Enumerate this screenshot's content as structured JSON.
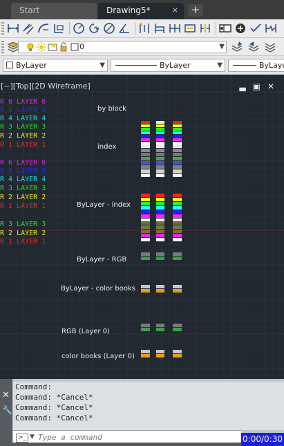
{
  "tabs": [
    {
      "label": "Start",
      "active": false
    },
    {
      "label": "Drawing5*",
      "active": true
    }
  ],
  "tab_close_glyph": "×",
  "tab_add_glyph": "+",
  "layer_toolbar": {
    "current_layer": "0",
    "icons": [
      "layer-properties-icon",
      "light-bulb-icon",
      "sun-freeze-icon",
      "lock-icon",
      "color-square-icon"
    ]
  },
  "properties_toolbar": {
    "color": "ByLayer",
    "linetype": "ByLayer",
    "lineweight": "ByLayer"
  },
  "viewport": {
    "label": "[−][Top][2D Wireframe]",
    "controls": [
      "▃",
      "▣",
      "✕"
    ]
  },
  "legend": [
    {
      "text": "R 6  LAYER 6",
      "color": "#e020e0"
    },
    {
      "text": "R 5  LAYER 5",
      "color": "#2a2ad8"
    },
    {
      "text": "R 4  LAYER 4",
      "color": "#2ad8e6"
    },
    {
      "text": "R 3  LAYER 3",
      "color": "#2ad82a"
    },
    {
      "text": "R 2  LAYER 2",
      "color": "#e6e62a"
    },
    {
      "text": "R 1  LAYER 1",
      "color": "#e62a2a"
    },
    {
      "text": "R 6  LAYER 6",
      "color": "#e020e0"
    },
    {
      "text": "R 5  LAYER 5",
      "color": "#2a2ad8"
    },
    {
      "text": "R 4  LAYER 4",
      "color": "#2ad8e6"
    },
    {
      "text": "R 3  LAYER 3",
      "color": "#2ad82a"
    },
    {
      "text": "R 2  LAYER 2",
      "color": "#e6e62a"
    },
    {
      "text": "R 1  LAYER 1",
      "color": "#e62a2a"
    },
    {
      "text": "R 3  LAYER 3",
      "color": "#2ad82a"
    },
    {
      "text": "R 2  LAYER 2",
      "color": "#e6e62a"
    },
    {
      "text": "R 1  LAYER 1",
      "color": "#e62a2a"
    }
  ],
  "sections": [
    {
      "label": "by block",
      "colors": [
        "#ff2020",
        "#ffff20",
        "#20ff20",
        "#20ffff",
        "#2020ff",
        "#ff20ff",
        "#ffffff"
      ]
    },
    {
      "label": "index",
      "colors": [
        "#e8e8e8",
        "#8c8c8c",
        "#787878",
        "#50a050",
        "#5050d0",
        "#808080",
        "#d0d0d0",
        "#ffffff"
      ]
    },
    {
      "label": "ByLayer - index",
      "colors": [
        "#ff2020",
        "#ffff20",
        "#20ff20",
        "#20ffff",
        "#2020ff",
        "#ff20ff",
        "#ffffff"
      ]
    },
    {
      "label": "",
      "colors": [
        "#6f6a40",
        "#6a8040",
        "#8a6a30",
        "#ff20ff",
        "#ffffff"
      ]
    },
    {
      "label": "ByLayer - RGB",
      "colors": [
        "#7a7a7a",
        "#3aa04a"
      ]
    },
    {
      "label": "ByLayer - color books",
      "colors": [
        "#c8c8c8",
        "#e8a010"
      ]
    },
    {
      "label": "RGB (Layer 0)",
      "colors": [
        "#7a7a7a",
        "#3aa04a"
      ]
    },
    {
      "label": "color books (Layer 0)",
      "colors": [
        "#c8c8c8",
        "#e8a010"
      ]
    }
  ],
  "command_history": [
    "Command:",
    "Command: *Cancel*",
    "Command: *Cancel*",
    "Command: *Cancel*"
  ],
  "command_input": {
    "placeholder": "Type a command",
    "prompt_glyph": ">_"
  },
  "command_side": {
    "close_glyph": "✕",
    "customize_glyph": "🔧"
  },
  "recording_timer": "0:00/0:30",
  "colors": {
    "canvas_bg": "#212830",
    "grid_major": "#2c343d",
    "grid_minor": "#262e36",
    "axis_red": "#5a2a2e",
    "axis_green": "#2a4a36",
    "recording_bg": "#1a1ee0"
  }
}
